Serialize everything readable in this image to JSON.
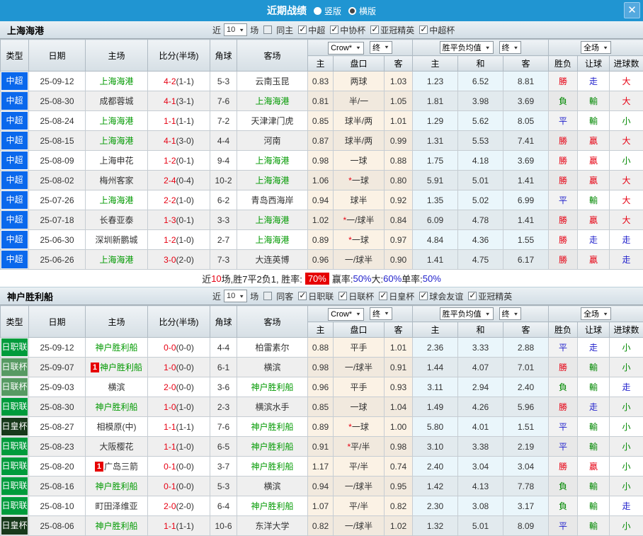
{
  "colors": {
    "topbar_blue": "#2095D2",
    "accent_red": "#E60012",
    "accent_green": "#008800",
    "accent_blue": "#2222CC",
    "team_green": "#009900",
    "win_badge_red": "#E60000",
    "league_colors": {
      "中超": "#0A68EC",
      "日职联": "#009B3C",
      "日联杯": "#579A63",
      "日皇杯": "#18391B"
    }
  },
  "topbar": {
    "title": "近期战绩",
    "layout_options": [
      {
        "label": "竖版",
        "selected": false
      },
      {
        "label": "横版",
        "selected": true
      }
    ],
    "close_label": "✕"
  },
  "table_header": {
    "left_cols": [
      "类型",
      "日期",
      "主场",
      "比分(半场)",
      "角球",
      "客场"
    ],
    "odds_group": {
      "bookmaker": "Crow*",
      "period": "终",
      "cols": [
        "主",
        "盘口",
        "客"
      ]
    },
    "avg_group": {
      "label": "胜平负均值",
      "period": "终",
      "cols": [
        "主",
        "和",
        "客"
      ]
    },
    "result_group": {
      "scope": "全场",
      "cols": [
        "胜负",
        "让球",
        "进球数"
      ]
    }
  },
  "sections": [
    {
      "team": "上海海港",
      "filter": {
        "near": "近",
        "count": "10",
        "games": "场",
        "same": {
          "label": "同主",
          "checked": false
        },
        "comps": [
          {
            "label": "中超",
            "checked": true
          },
          {
            "label": "中协杯",
            "checked": true
          },
          {
            "label": "亚冠精英",
            "checked": true
          },
          {
            "label": "中超杯",
            "checked": true
          }
        ]
      },
      "rows": [
        {
          "league": "中超",
          "date": "25-09-12",
          "home": "上海海港",
          "home_team": true,
          "home_rank": "",
          "score": "4-2",
          "half": "(1-1)",
          "corners": "5-3",
          "away": "云南玉昆",
          "away_team": false,
          "home_odds": "0.83",
          "star": false,
          "handicap": "两球",
          "away_odds": "1.03",
          "avg_home": "1.23",
          "avg_draw": "6.52",
          "avg_away": "8.81",
          "result": "勝",
          "handicap_result": "走",
          "goals_result": "大"
        },
        {
          "league": "中超",
          "date": "25-08-30",
          "home": "成都蓉城",
          "home_team": false,
          "home_rank": "",
          "score": "4-1",
          "half": "(3-1)",
          "corners": "7-6",
          "away": "上海海港",
          "away_team": true,
          "home_odds": "0.81",
          "star": false,
          "handicap": "半/一",
          "away_odds": "1.05",
          "avg_home": "1.81",
          "avg_draw": "3.98",
          "avg_away": "3.69",
          "result": "負",
          "handicap_result": "輸",
          "goals_result": "大"
        },
        {
          "league": "中超",
          "date": "25-08-24",
          "home": "上海海港",
          "home_team": true,
          "home_rank": "",
          "score": "1-1",
          "half": "(1-1)",
          "corners": "7-2",
          "away": "天津津门虎",
          "away_team": false,
          "home_odds": "0.85",
          "star": false,
          "handicap": "球半/两",
          "away_odds": "1.01",
          "avg_home": "1.29",
          "avg_draw": "5.62",
          "avg_away": "8.05",
          "result": "平",
          "handicap_result": "輸",
          "goals_result": "小"
        },
        {
          "league": "中超",
          "date": "25-08-15",
          "home": "上海海港",
          "home_team": true,
          "home_rank": "",
          "score": "4-1",
          "half": "(3-0)",
          "corners": "4-4",
          "away": "河南",
          "away_team": false,
          "home_odds": "0.87",
          "star": false,
          "handicap": "球半/两",
          "away_odds": "0.99",
          "avg_home": "1.31",
          "avg_draw": "5.53",
          "avg_away": "7.41",
          "result": "勝",
          "handicap_result": "贏",
          "goals_result": "大"
        },
        {
          "league": "中超",
          "date": "25-08-09",
          "home": "上海申花",
          "home_team": false,
          "home_rank": "",
          "score": "1-2",
          "half": "(0-1)",
          "corners": "9-4",
          "away": "上海海港",
          "away_team": true,
          "home_odds": "0.98",
          "star": false,
          "handicap": "一球",
          "away_odds": "0.88",
          "avg_home": "1.75",
          "avg_draw": "4.18",
          "avg_away": "3.69",
          "result": "勝",
          "handicap_result": "贏",
          "goals_result": "小"
        },
        {
          "league": "中超",
          "date": "25-08-02",
          "home": "梅州客家",
          "home_team": false,
          "home_rank": "",
          "score": "2-4",
          "half": "(0-4)",
          "corners": "10-2",
          "away": "上海海港",
          "away_team": true,
          "home_odds": "1.06",
          "star": true,
          "handicap": "一球",
          "away_odds": "0.80",
          "avg_home": "5.91",
          "avg_draw": "5.01",
          "avg_away": "1.41",
          "result": "勝",
          "handicap_result": "贏",
          "goals_result": "大"
        },
        {
          "league": "中超",
          "date": "25-07-26",
          "home": "上海海港",
          "home_team": true,
          "home_rank": "",
          "score": "2-2",
          "half": "(1-0)",
          "corners": "6-2",
          "away": "青岛西海岸",
          "away_team": false,
          "home_odds": "0.94",
          "star": false,
          "handicap": "球半",
          "away_odds": "0.92",
          "avg_home": "1.35",
          "avg_draw": "5.02",
          "avg_away": "6.99",
          "result": "平",
          "handicap_result": "輸",
          "goals_result": "大"
        },
        {
          "league": "中超",
          "date": "25-07-18",
          "home": "长春亚泰",
          "home_team": false,
          "home_rank": "",
          "score": "1-3",
          "half": "(0-1)",
          "corners": "3-3",
          "away": "上海海港",
          "away_team": true,
          "home_odds": "1.02",
          "star": true,
          "handicap": "一/球半",
          "away_odds": "0.84",
          "avg_home": "6.09",
          "avg_draw": "4.78",
          "avg_away": "1.41",
          "result": "勝",
          "handicap_result": "贏",
          "goals_result": "大"
        },
        {
          "league": "中超",
          "date": "25-06-30",
          "home": "深圳新鹏城",
          "home_team": false,
          "home_rank": "",
          "score": "1-2",
          "half": "(1-0)",
          "corners": "2-7",
          "away": "上海海港",
          "away_team": true,
          "home_odds": "0.89",
          "star": true,
          "handicap": "一球",
          "away_odds": "0.97",
          "avg_home": "4.84",
          "avg_draw": "4.36",
          "avg_away": "1.55",
          "result": "勝",
          "handicap_result": "走",
          "goals_result": "走"
        },
        {
          "league": "中超",
          "date": "25-06-26",
          "home": "上海海港",
          "home_team": true,
          "home_rank": "",
          "score": "3-0",
          "half": "(2-0)",
          "corners": "7-3",
          "away": "大连英博",
          "away_team": false,
          "home_odds": "0.96",
          "star": false,
          "handicap": "一/球半",
          "away_odds": "0.90",
          "avg_home": "1.41",
          "avg_draw": "4.75",
          "avg_away": "6.17",
          "result": "勝",
          "handicap_result": "贏",
          "goals_result": "走"
        }
      ],
      "summary": {
        "prefix": "近",
        "count": "10",
        "record_text": "场,胜7平2负1, 胜率:",
        "win_rate": "70%",
        "parts": [
          {
            "label": "赢率:",
            "value": "50%"
          },
          {
            "label": " 大:",
            "value": "60%"
          },
          {
            "label": " 单率:",
            "value": "50%"
          }
        ]
      }
    },
    {
      "team": "神户胜利船",
      "filter": {
        "near": "近",
        "count": "10",
        "games": "场",
        "same": {
          "label": "同客",
          "checked": false
        },
        "comps": [
          {
            "label": "日职联",
            "checked": true
          },
          {
            "label": "日联杯",
            "checked": true
          },
          {
            "label": "日皇杯",
            "checked": true
          },
          {
            "label": "球会友谊",
            "checked": true
          },
          {
            "label": "亚冠精英",
            "checked": true
          }
        ]
      },
      "rows": [
        {
          "league": "日职联",
          "date": "25-09-12",
          "home": "神户胜利船",
          "home_team": true,
          "home_rank": "",
          "score": "0-0",
          "half": "(0-0)",
          "corners": "4-4",
          "away": "柏雷素尔",
          "away_team": false,
          "home_odds": "0.88",
          "star": false,
          "handicap": "平手",
          "away_odds": "1.01",
          "avg_home": "2.36",
          "avg_draw": "3.33",
          "avg_away": "2.88",
          "result": "平",
          "handicap_result": "走",
          "goals_result": "小"
        },
        {
          "league": "日联杯",
          "date": "25-09-07",
          "home": "神户胜利船",
          "home_team": true,
          "home_rank": "1",
          "score": "1-0",
          "half": "(0-0)",
          "corners": "6-1",
          "away": "横滨",
          "away_team": false,
          "home_odds": "0.98",
          "star": false,
          "handicap": "一/球半",
          "away_odds": "0.91",
          "avg_home": "1.44",
          "avg_draw": "4.07",
          "avg_away": "7.01",
          "result": "勝",
          "handicap_result": "輸",
          "goals_result": "小"
        },
        {
          "league": "日联杯",
          "date": "25-09-03",
          "home": "横滨",
          "home_team": false,
          "home_rank": "",
          "score": "2-0",
          "half": "(0-0)",
          "corners": "3-6",
          "away": "神户胜利船",
          "away_team": true,
          "home_odds": "0.96",
          "star": false,
          "handicap": "平手",
          "away_odds": "0.93",
          "avg_home": "3.11",
          "avg_draw": "2.94",
          "avg_away": "2.40",
          "result": "負",
          "handicap_result": "輸",
          "goals_result": "走"
        },
        {
          "league": "日职联",
          "date": "25-08-30",
          "home": "神户胜利船",
          "home_team": true,
          "home_rank": "",
          "score": "1-0",
          "half": "(1-0)",
          "corners": "2-3",
          "away": "横滨水手",
          "away_team": false,
          "home_odds": "0.85",
          "star": false,
          "handicap": "一球",
          "away_odds": "1.04",
          "avg_home": "1.49",
          "avg_draw": "4.26",
          "avg_away": "5.96",
          "result": "勝",
          "handicap_result": "走",
          "goals_result": "小"
        },
        {
          "league": "日皇杯",
          "date": "25-08-27",
          "home": "相模原(中)",
          "home_team": false,
          "home_rank": "",
          "score": "1-1",
          "half": "(1-1)",
          "corners": "7-6",
          "away": "神户胜利船",
          "away_team": true,
          "home_odds": "0.89",
          "star": true,
          "handicap": "一球",
          "away_odds": "1.00",
          "avg_home": "5.80",
          "avg_draw": "4.01",
          "avg_away": "1.51",
          "result": "平",
          "handicap_result": "輸",
          "goals_result": "小"
        },
        {
          "league": "日职联",
          "date": "25-08-23",
          "home": "大阪樱花",
          "home_team": false,
          "home_rank": "",
          "score": "1-1",
          "half": "(1-0)",
          "corners": "6-5",
          "away": "神户胜利船",
          "away_team": true,
          "home_odds": "0.91",
          "star": true,
          "handicap": "平/半",
          "away_odds": "0.98",
          "avg_home": "3.10",
          "avg_draw": "3.38",
          "avg_away": "2.19",
          "result": "平",
          "handicap_result": "輸",
          "goals_result": "小"
        },
        {
          "league": "日职联",
          "date": "25-08-20",
          "home": "广岛三箭",
          "home_team": false,
          "home_rank": "1",
          "score": "0-1",
          "half": "(0-0)",
          "corners": "3-7",
          "away": "神户胜利船",
          "away_team": true,
          "home_odds": "1.17",
          "star": false,
          "handicap": "平/半",
          "away_odds": "0.74",
          "avg_home": "2.40",
          "avg_draw": "3.04",
          "avg_away": "3.04",
          "result": "勝",
          "handicap_result": "贏",
          "goals_result": "小"
        },
        {
          "league": "日职联",
          "date": "25-08-16",
          "home": "神户胜利船",
          "home_team": true,
          "home_rank": "",
          "score": "0-1",
          "half": "(0-0)",
          "corners": "5-3",
          "away": "横滨",
          "away_team": false,
          "home_odds": "0.94",
          "star": false,
          "handicap": "一/球半",
          "away_odds": "0.95",
          "avg_home": "1.42",
          "avg_draw": "4.13",
          "avg_away": "7.78",
          "result": "負",
          "handicap_result": "輸",
          "goals_result": "小"
        },
        {
          "league": "日职联",
          "date": "25-08-10",
          "home": "町田泽维亚",
          "home_team": false,
          "home_rank": "",
          "score": "2-0",
          "half": "(2-0)",
          "corners": "6-4",
          "away": "神户胜利船",
          "away_team": true,
          "home_odds": "1.07",
          "star": false,
          "handicap": "平/半",
          "away_odds": "0.82",
          "avg_home": "2.30",
          "avg_draw": "3.08",
          "avg_away": "3.17",
          "result": "負",
          "handicap_result": "輸",
          "goals_result": "走"
        },
        {
          "league": "日皇杯",
          "date": "25-08-06",
          "home": "神户胜利船",
          "home_team": true,
          "home_rank": "",
          "score": "1-1",
          "half": "(1-1)",
          "corners": "10-6",
          "away": "东洋大学",
          "away_team": false,
          "home_odds": "0.82",
          "star": false,
          "handicap": "一/球半",
          "away_odds": "1.02",
          "avg_home": "1.32",
          "avg_draw": "5.01",
          "avg_away": "8.09",
          "result": "平",
          "handicap_result": "輸",
          "goals_result": "小"
        }
      ],
      "summary": null
    }
  ]
}
